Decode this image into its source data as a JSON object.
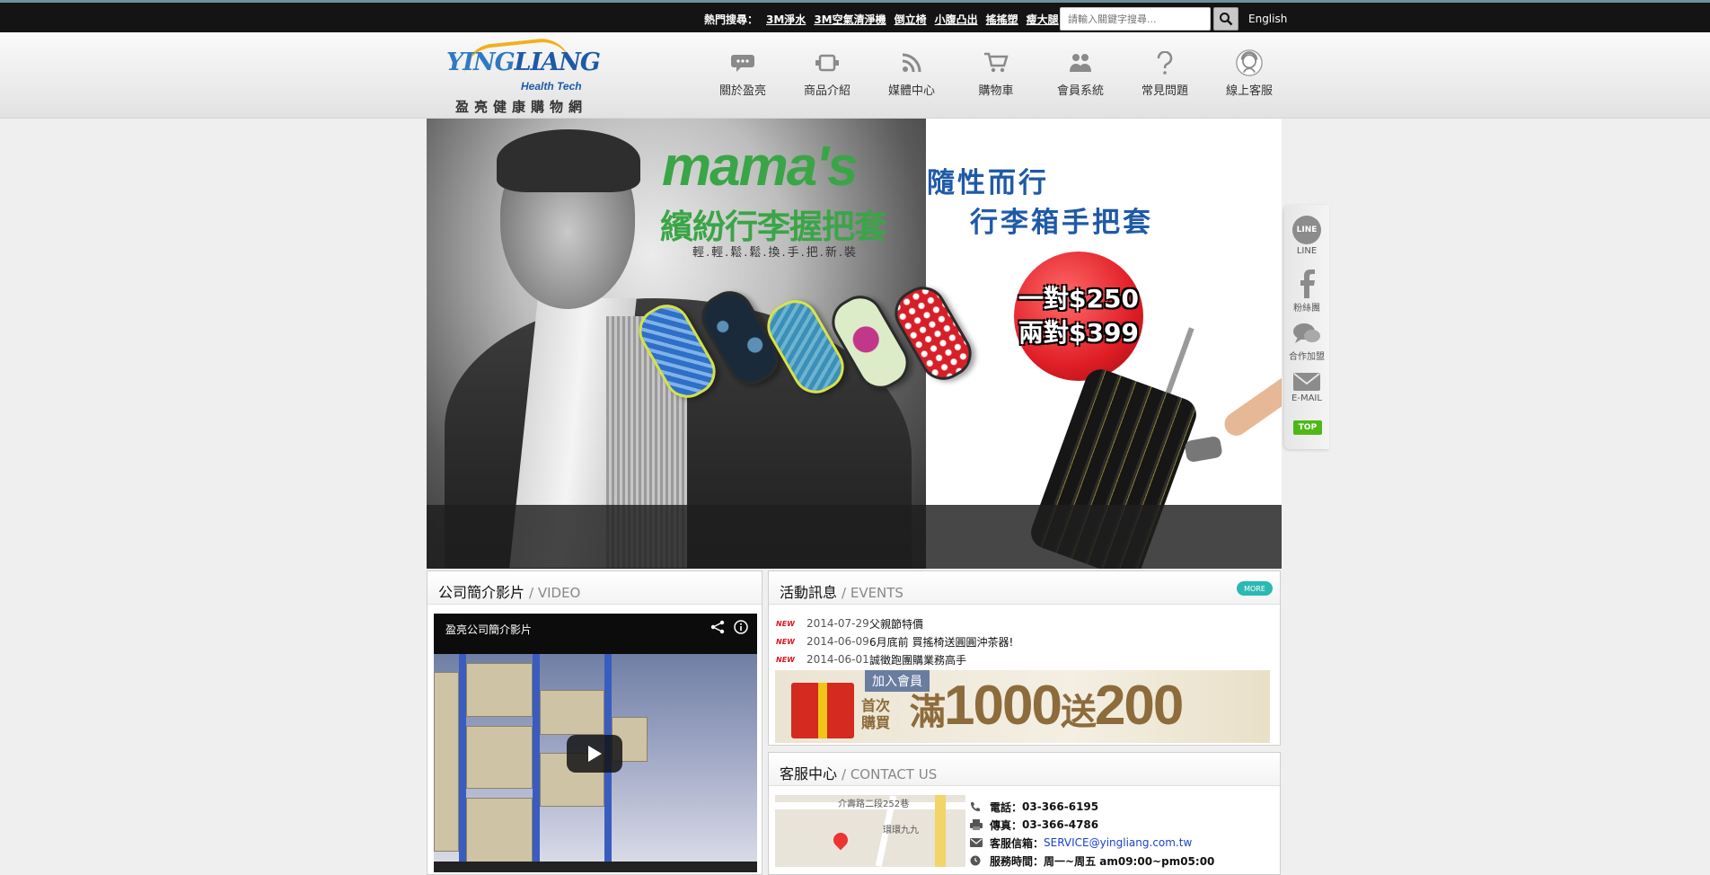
{
  "topbar": {
    "hot_label": "熱門搜尋：",
    "hot_links": [
      "3M淨水",
      "3M空氣清淨機",
      "倒立椅",
      "小腹凸出",
      "搖搖塑",
      "瘦大腿"
    ],
    "search_placeholder": "請輸入關鍵字搜尋...",
    "language_link": "English"
  },
  "logo": {
    "word_left": "YING",
    "word_right": "LIANG",
    "tagline": "Health Tech",
    "chinese_name": "盈亮健康購物網"
  },
  "nav": {
    "items": [
      {
        "label": "關於盈亮",
        "icon": "speech-bubble-icon"
      },
      {
        "label": "商品介紹",
        "icon": "product-icon"
      },
      {
        "label": "媒體中心",
        "icon": "rss-icon"
      },
      {
        "label": "購物車",
        "icon": "cart-icon"
      },
      {
        "label": "會員系統",
        "icon": "members-icon"
      },
      {
        "label": "常見問題",
        "icon": "question-icon"
      },
      {
        "label": "線上客服",
        "icon": "support-avatar-icon"
      }
    ]
  },
  "banner": {
    "brand": "mama's",
    "line1": "隨性而行",
    "line2": "繽紛行李握把套",
    "line3": "行李箱手把套",
    "line4": "輕.輕.鬆.鬆.換.手.把.新.裝",
    "price1": "一對$250",
    "price2": "兩對$399"
  },
  "side": {
    "line_icon_text": "LINE",
    "line_label": "LINE",
    "fans_label": "粉絲團",
    "coop_label": "合作加盟",
    "email_label": "E-MAIL",
    "top_label": "TOP"
  },
  "video": {
    "title_cn": "公司簡介影片",
    "title_en": "/ VIDEO",
    "video_title": "盈亮公司簡介影片"
  },
  "events": {
    "title_cn": "活動訊息",
    "title_en": "/ EVENTS",
    "more": "MORE",
    "new_tag": "NEW",
    "items": [
      {
        "date": "2014-07-29",
        "text": "父親節特價"
      },
      {
        "date": "2014-06-09",
        "text": "6月底前 買搖椅送圓圓沖茶器!"
      },
      {
        "date": "2014-06-01",
        "text": "誠徵跑團購業務高手"
      }
    ],
    "promo": {
      "join": "加入會員",
      "first": "首次購買",
      "man": "滿",
      "amount": "1000",
      "song": "送",
      "gift": "200"
    }
  },
  "contact": {
    "title_cn": "客服中心",
    "title_en": "/ CONTACT US",
    "phone_label": "電話：",
    "phone": "03-366-6195",
    "fax_label": "傳真：",
    "fax": "03-366-4786",
    "email_label": "客服信箱：",
    "email": "SERVICE@yingliang.com.tw",
    "hours_label": "服務時間：",
    "hours": "周一~周五 am09:00~pm05:00",
    "map_road": "介壽路二段252巷",
    "map_poi": "環環九九"
  }
}
